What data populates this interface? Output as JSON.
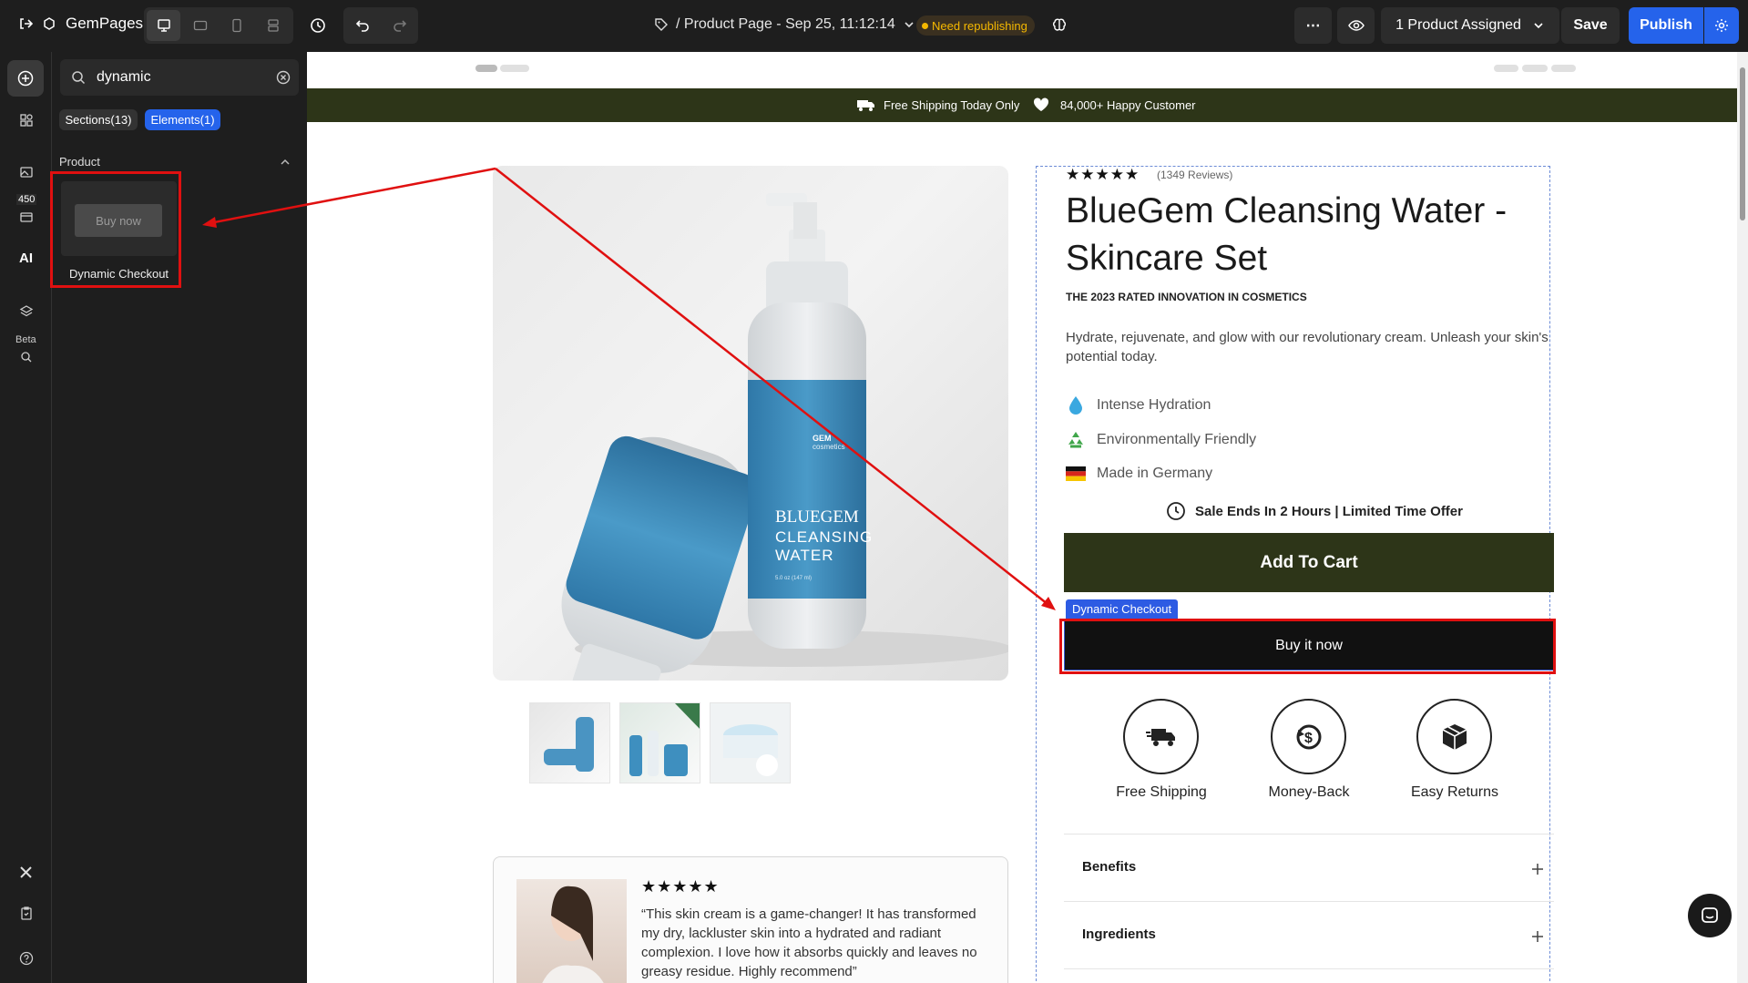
{
  "topbar": {
    "app_name": "GemPages 7",
    "page_title": "/ Product Page - Sep 25, 11:12:14",
    "status_badge": "Need republishing",
    "assigned": "1 Product Assigned",
    "save_label": "Save",
    "publish_label": "Publish"
  },
  "sidebar": {
    "count_badge": "450",
    "ai_label": "AI",
    "beta_label": "Beta"
  },
  "panel": {
    "search_value": "dynamic",
    "tabs": [
      {
        "label": "Sections(13)"
      },
      {
        "label": "Elements(1)"
      }
    ],
    "group_label": "Product",
    "element": {
      "preview_label": "Buy now",
      "name": "Dynamic Checkout"
    }
  },
  "banner": {
    "shipping": "Free Shipping Today Only",
    "customers": "84,000+ Happy Customer"
  },
  "product": {
    "reviews": "(1349 Reviews)",
    "title": "BlueGem Cleansing Water - Skincare Set",
    "subtitle": "THE 2023 RATED INNOVATION IN COSMETICS",
    "description": "Hydrate, rejuvenate, and glow with our revolutionary cream. Unleash your skin's potential today.",
    "features": [
      {
        "label": "Intense Hydration",
        "icon": "droplet-icon"
      },
      {
        "label": "Environmentally Friendly",
        "icon": "recycle-icon"
      },
      {
        "label": "Made in Germany",
        "icon": "germany-flag-icon"
      }
    ],
    "sale_text": "Sale Ends In 2 Hours | Limited Time Offer",
    "add_to_cart": "Add To Cart",
    "dynamic_checkout_tag": "Dynamic Checkout",
    "buy_now": "Buy it now",
    "badges": [
      {
        "label": "Free Shipping",
        "icon": "truck-icon"
      },
      {
        "label": "Money-Back",
        "icon": "money-back-icon"
      },
      {
        "label": "Easy Returns",
        "icon": "box-icon"
      }
    ],
    "accordion": [
      {
        "label": "Benefits"
      },
      {
        "label": "Ingredients"
      }
    ],
    "bottle": {
      "brand": "GEM",
      "brand_sub": "cosmetics",
      "line1": "BLUEGEM",
      "line2": "CLEANSING",
      "line3": "WATER",
      "volume": "5.0 oz (147 ml)"
    }
  },
  "review": {
    "text": "“This skin cream is a game-changer! It has transformed my dry, lackluster skin into a hydrated and radiant complexion. I love how it absorbs quickly and leaves no greasy residue. Highly recommend”"
  },
  "colors": {
    "accent": "#2563eb",
    "banner": "#2d3518",
    "annotation": "#e01010",
    "bottle_label": "#3a86b4"
  }
}
